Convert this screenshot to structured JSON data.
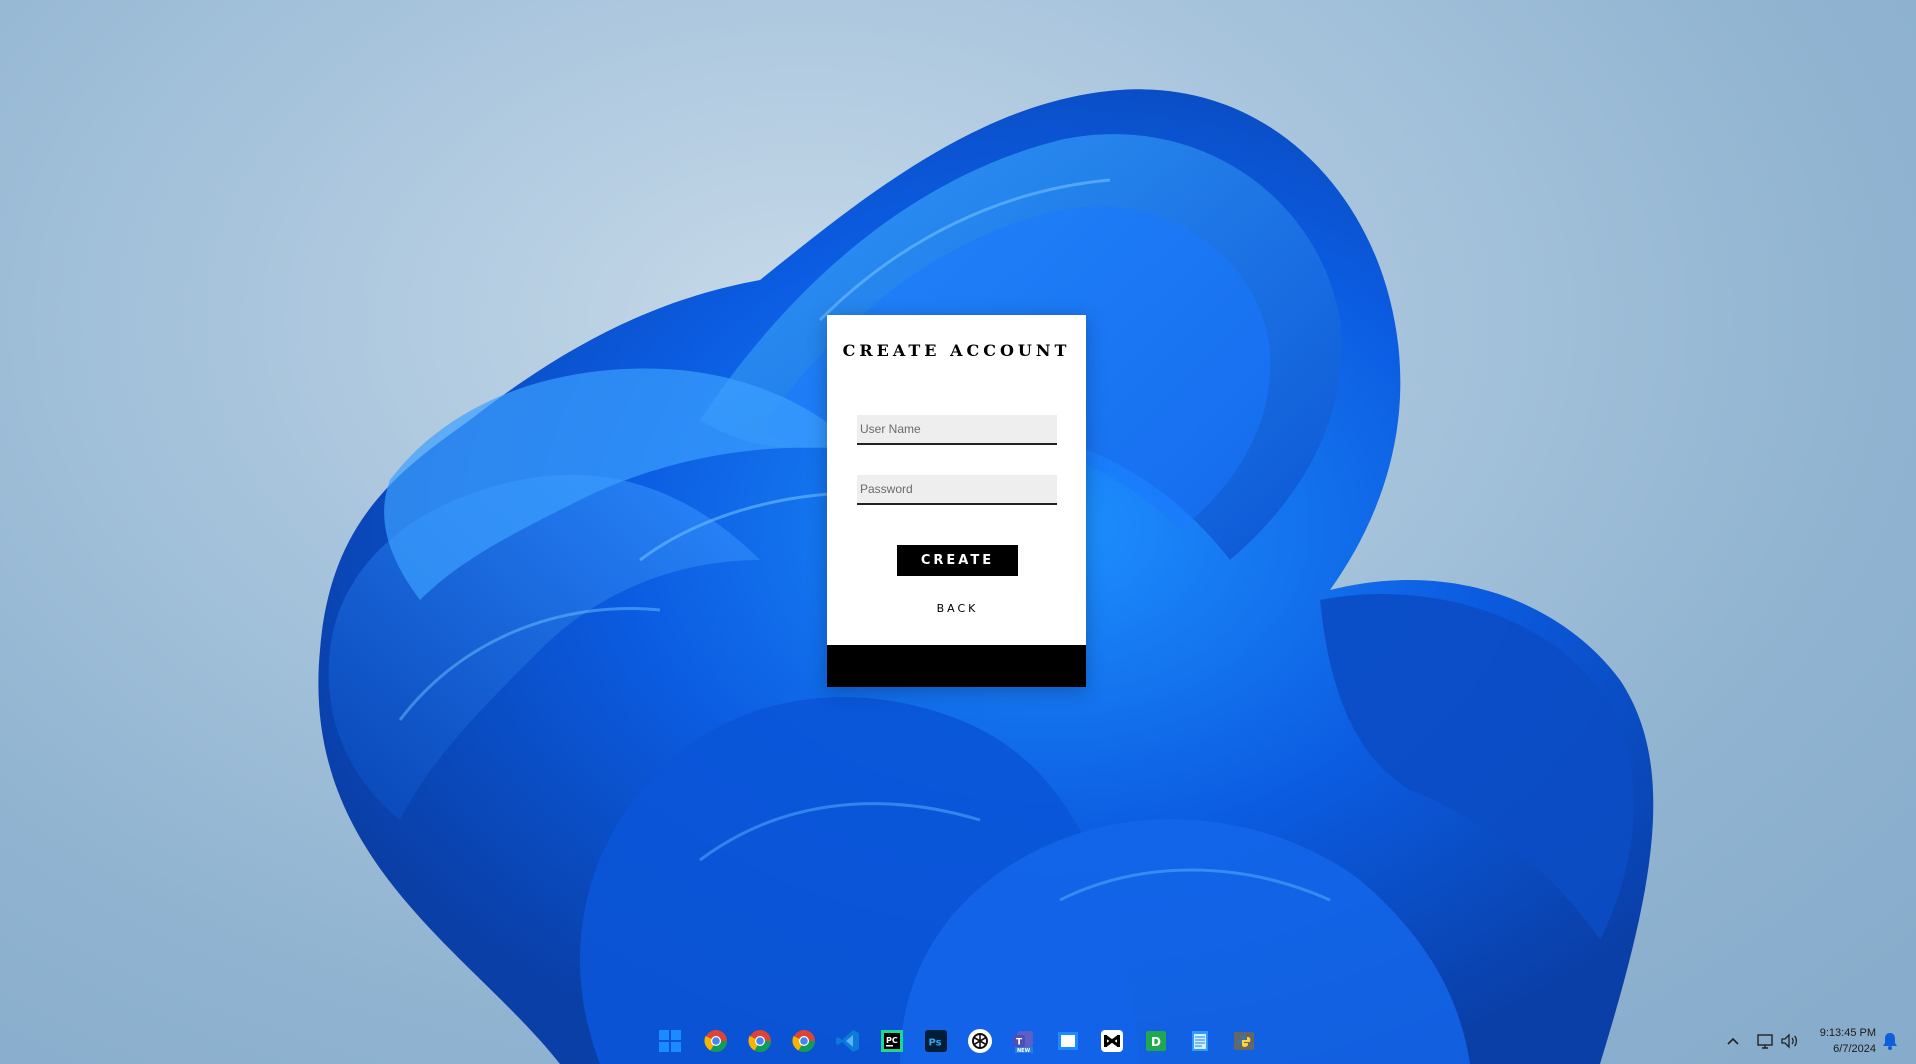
{
  "window": {
    "title": "CREATE ACCOUNT",
    "username": {
      "value": "",
      "placeholder": "User Name"
    },
    "password": {
      "value": "",
      "placeholder": "Password"
    },
    "create_label": "CREATE",
    "back_label": "BACK"
  },
  "taskbar": {
    "apps": [
      {
        "name": "start-menu-icon"
      },
      {
        "name": "chrome-icon"
      },
      {
        "name": "chrome-icon"
      },
      {
        "name": "chrome-icon"
      },
      {
        "name": "vscode-icon"
      },
      {
        "name": "pycharm-icon"
      },
      {
        "name": "photoshop-icon"
      },
      {
        "name": "chatgpt-icon"
      },
      {
        "name": "teams-icon"
      },
      {
        "name": "window-app-icon"
      },
      {
        "name": "capcut-icon"
      },
      {
        "name": "app-d-icon"
      },
      {
        "name": "notepad-icon"
      },
      {
        "name": "python-icon"
      }
    ],
    "ps_label": "Ps",
    "pc_label": "PC",
    "teams_badge": "NEW",
    "d_label": "D"
  },
  "tray": {
    "time": "9:13:45 PM",
    "date": "6/7/2024"
  },
  "colors": {
    "accent_blue": "#0f5fd8",
    "button_black": "#000000",
    "field_bg": "#eeeeee"
  }
}
